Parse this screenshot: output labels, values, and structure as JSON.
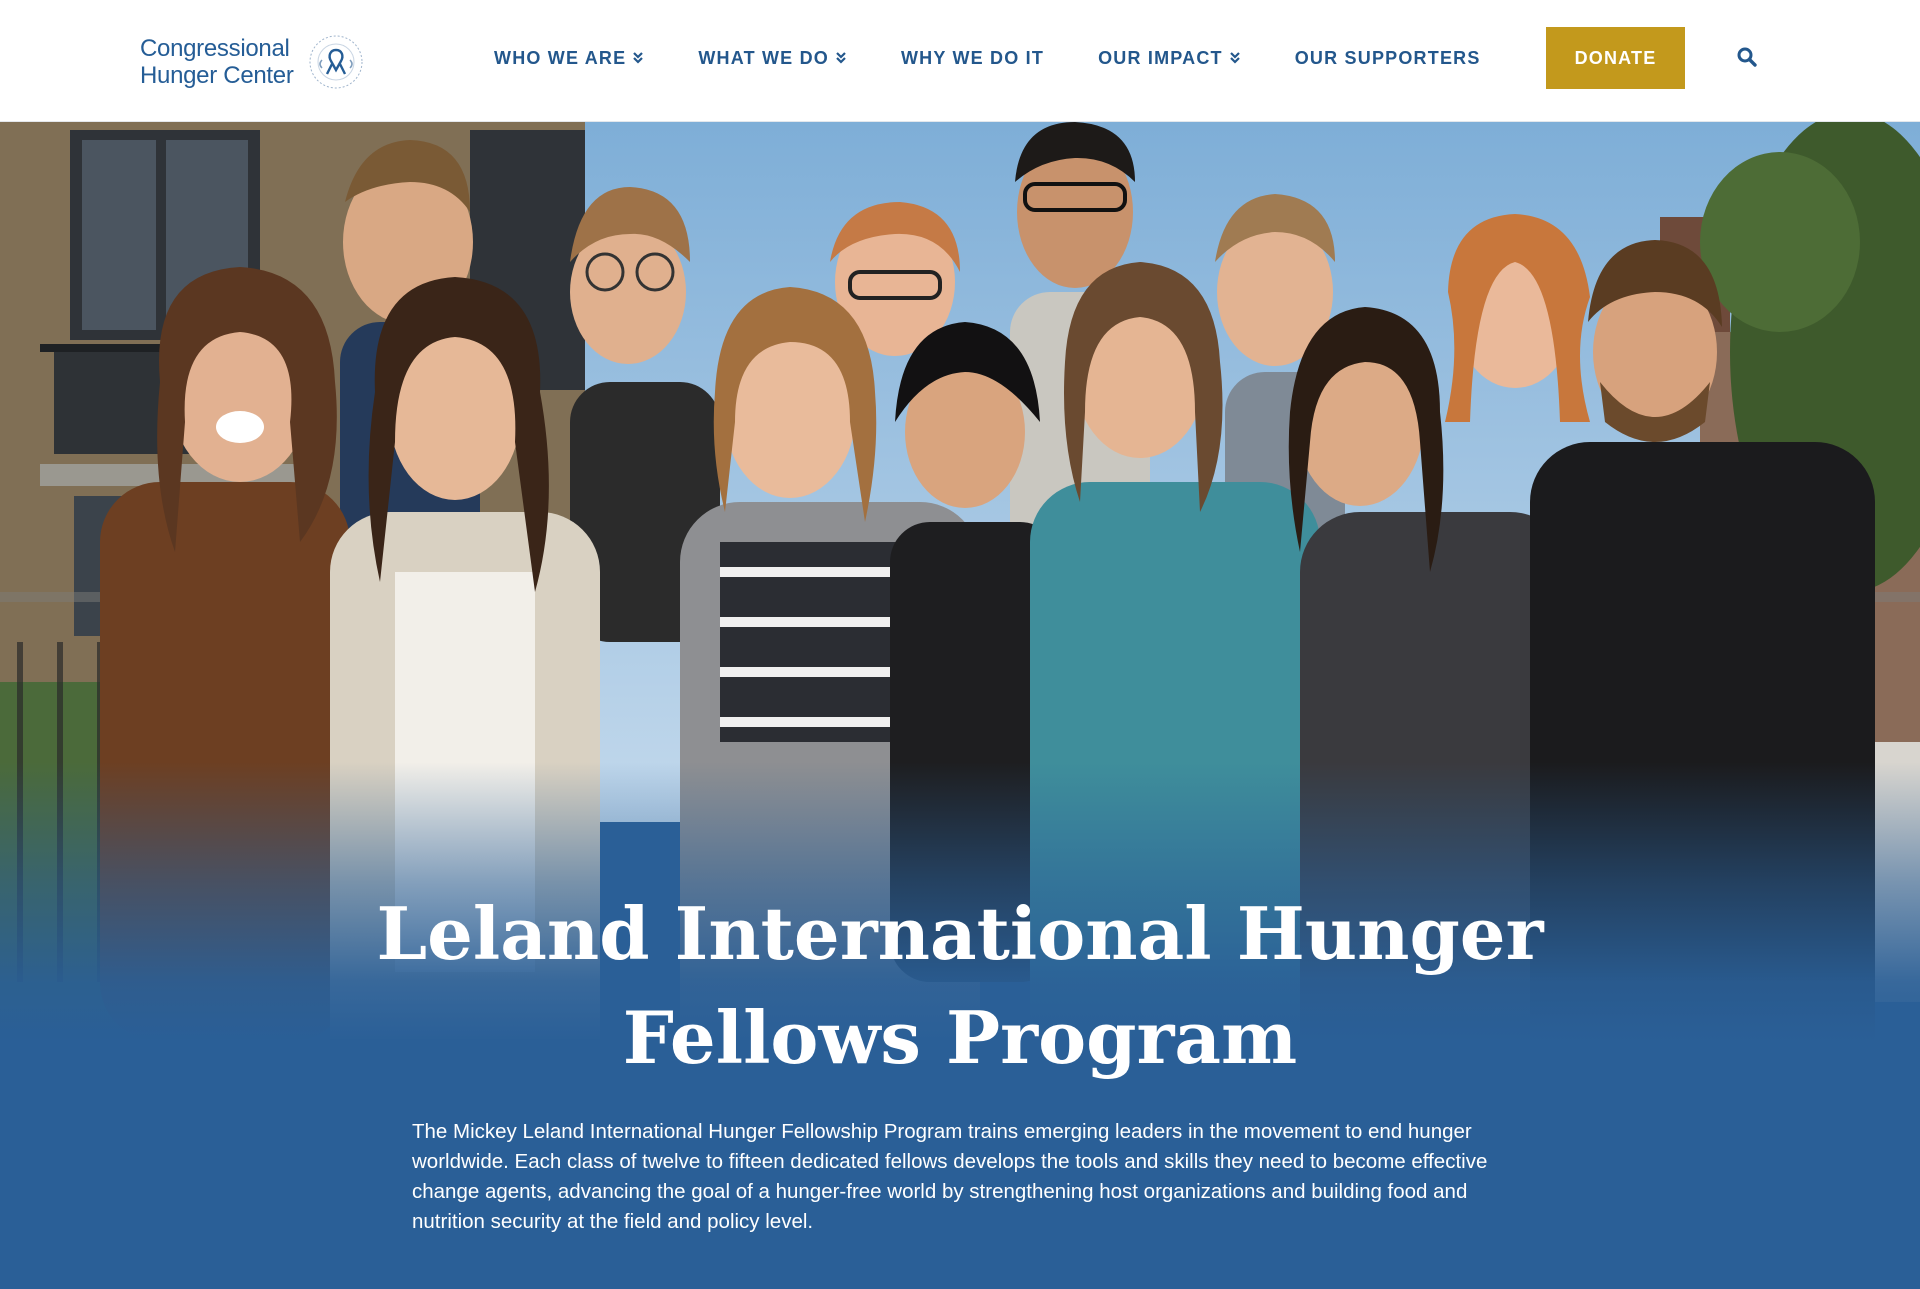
{
  "logo": {
    "line1": "Congressional",
    "line2": "Hunger Center",
    "seal_icon": "ribbon-seal-icon"
  },
  "nav": {
    "items": [
      {
        "label": "WHO WE ARE",
        "has_dropdown": true
      },
      {
        "label": "WHAT WE DO",
        "has_dropdown": true
      },
      {
        "label": "WHY WE DO IT",
        "has_dropdown": false
      },
      {
        "label": "OUR IMPACT",
        "has_dropdown": true
      },
      {
        "label": "OUR SUPPORTERS",
        "has_dropdown": false
      }
    ],
    "donate_label": "DONATE",
    "search_icon": "search-icon"
  },
  "colors": {
    "brand_blue": "#23578c",
    "hero_blue": "#2a5f97",
    "donate_gold": "#c3991c"
  },
  "hero": {
    "image": "group-photo-of-fellows",
    "title": "Leland International Hunger Fellows Program",
    "description": "The Mickey Leland International Hunger Fellowship Program trains emerging leaders in the movement to end hunger worldwide. Each class of twelve to fifteen dedicated fellows develops the tools and skills they need to become effective change agents, advancing the goal of a hunger-free world by strengthening host organizations and building food and nutrition security at the field and policy level."
  }
}
